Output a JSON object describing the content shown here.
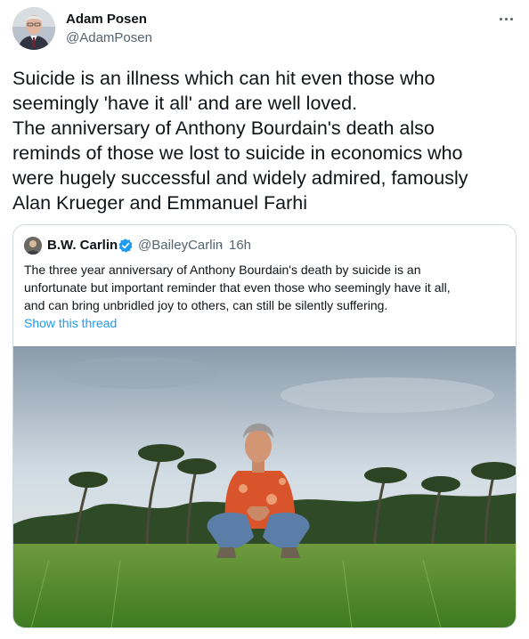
{
  "author": {
    "name": "Adam Posen",
    "handle": "@AdamPosen"
  },
  "tweet": {
    "lines": [
      "Suicide is an illness which can hit even those who",
      "seemingly 'have it all' and are well loved.",
      "The anniversary of Anthony Bourdain's death also",
      "reminds of those we lost to suicide in economics who",
      "were hugely successful and widely admired, famously",
      "Alan Krueger and Emmanuel Farhi"
    ]
  },
  "quote": {
    "name": "B.W. Carlin",
    "handle": "@BaileyCarlin",
    "separator": "·",
    "time": "16h",
    "lines": [
      "The three year anniversary of Anthony Bourdain's death by suicide is an",
      "unfortunate but important reminder that even those who seemingly have it all,",
      "and can bring unbridled joy to others, can still be silently suffering."
    ],
    "show_thread": "Show this thread"
  },
  "colors": {
    "link": "#1d9bf0",
    "secondary_text": "#536471",
    "border": "#cfd9de",
    "verified": "#1d9bf0"
  },
  "icons": {
    "more": "more-dots-icon",
    "verified": "verified-badge-icon"
  }
}
